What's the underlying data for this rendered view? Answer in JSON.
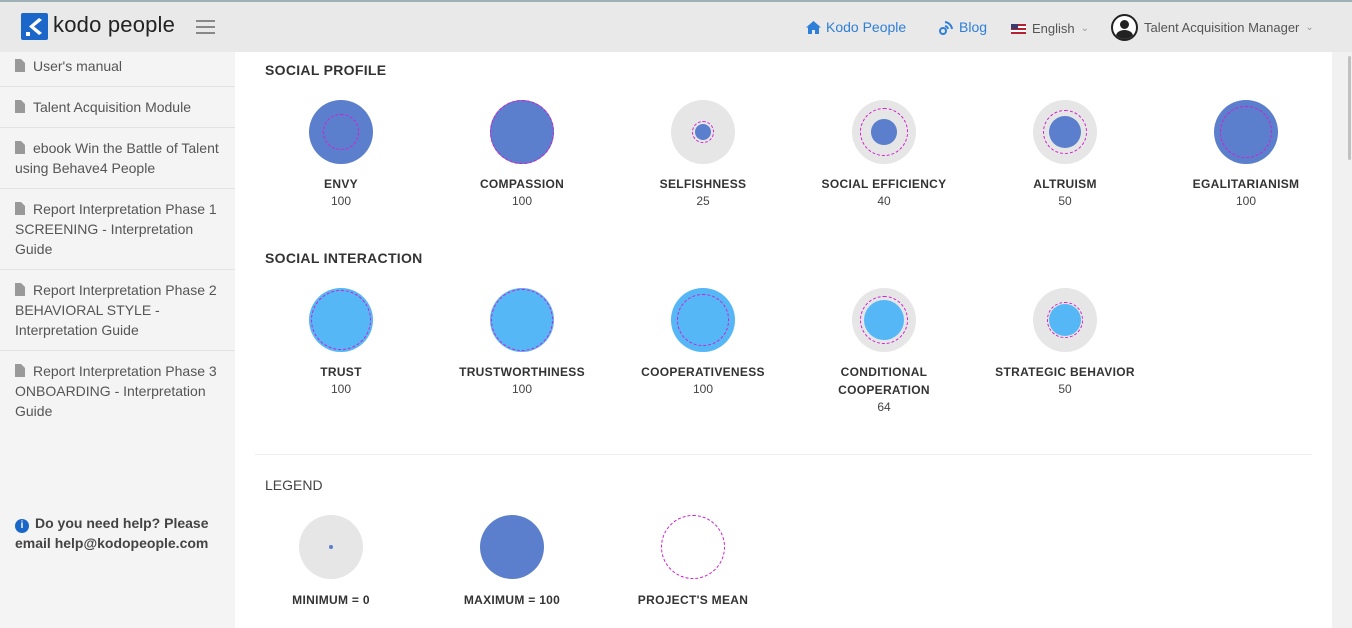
{
  "header": {
    "logo_text": "kodo people",
    "nav": [
      {
        "label": "Kodo People",
        "icon": "home-icon"
      },
      {
        "label": "Blog",
        "icon": "blog-icon"
      }
    ],
    "language": "English",
    "user_role": "Talent Acquisition Manager"
  },
  "sidebar": {
    "items": [
      {
        "label": "User's manual",
        "icon": "document-icon"
      },
      {
        "label": "Talent Acquisition Module",
        "icon": "document-icon"
      },
      {
        "label": "ebook Win the Battle of Talent using Behave4 People",
        "icon": "document-icon"
      },
      {
        "label": "Report Interpretation Phase 1 SCREENING - Interpretation Guide",
        "icon": "document-icon"
      },
      {
        "label": "Report Interpretation Phase 2 BEHAVIORAL STYLE - Interpretation Guide",
        "icon": "document-icon"
      },
      {
        "label": "Report Interpretation Phase 3 ONBOARDING - Interpretation Guide",
        "icon": "document-icon"
      }
    ],
    "help_text": "Do you need help? Please email help@kodopeople.com"
  },
  "colors": {
    "social_profile": "#5b7fcd",
    "social_interaction": "#55b7f5",
    "mean_ring": "#d21fd0",
    "background_circle": "#e6e6e6"
  },
  "sections": {
    "social_profile": {
      "title": "SOCIAL PROFILE",
      "metrics": [
        {
          "label": "ENVY",
          "value": 100,
          "mean": 55
        },
        {
          "label": "COMPASSION",
          "value": 100,
          "mean": 100
        },
        {
          "label": "SELFISHNESS",
          "value": 25,
          "mean": 35
        },
        {
          "label": "SOCIAL EFFICIENCY",
          "value": 40,
          "mean": 75
        },
        {
          "label": "ALTRUISM",
          "value": 50,
          "mean": 70
        },
        {
          "label": "EGALITARIANISM",
          "value": 100,
          "mean": 80
        }
      ]
    },
    "social_interaction": {
      "title": "SOCIAL INTERACTION",
      "metrics": [
        {
          "label": "TRUST",
          "value": 100,
          "mean": 95
        },
        {
          "label": "TRUSTWORTHINESS",
          "value": 100,
          "mean": 98
        },
        {
          "label": "COOPERATIVENESS",
          "value": 100,
          "mean": 80
        },
        {
          "label": "CONDITIONAL COOPERATION",
          "value": 64,
          "mean": 75
        },
        {
          "label": "STRATEGIC BEHAVIOR",
          "value": 50,
          "mean": 55
        }
      ]
    }
  },
  "legend": {
    "title": "LEGEND",
    "items": [
      {
        "label": "MINIMUM = 0"
      },
      {
        "label": "MAXIMUM = 100"
      },
      {
        "label": "PROJECT'S MEAN"
      }
    ]
  }
}
